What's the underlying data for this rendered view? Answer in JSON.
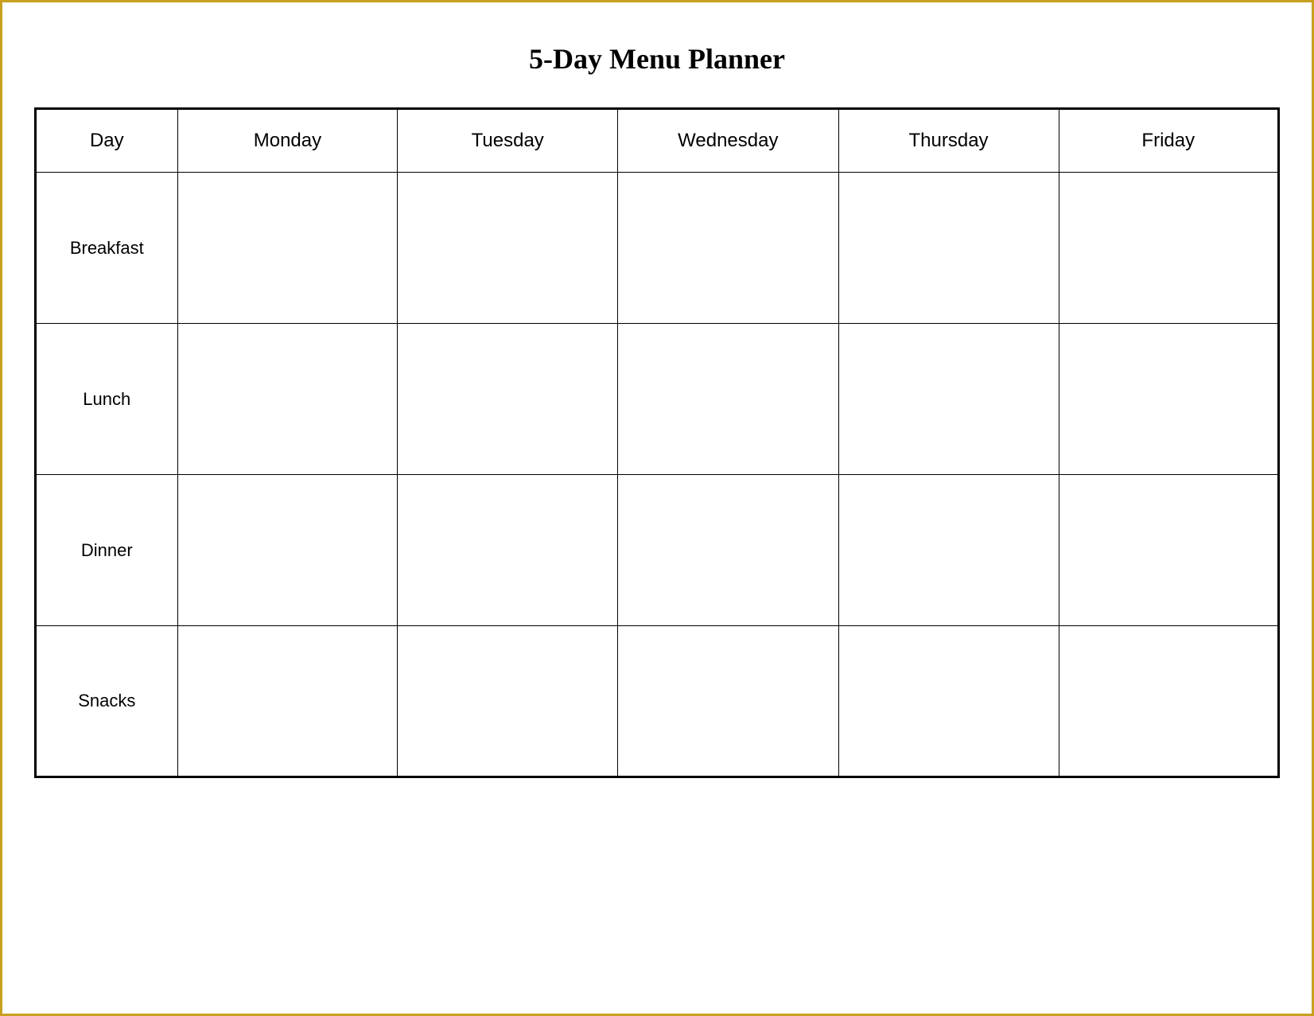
{
  "title": "5-Day Menu Planner",
  "table": {
    "headers": {
      "day": "Day",
      "monday": "Monday",
      "tuesday": "Tuesday",
      "wednesday": "Wednesday",
      "thursday": "Thursday",
      "friday": "Friday"
    },
    "rows": [
      {
        "label": "Breakfast"
      },
      {
        "label": "Lunch"
      },
      {
        "label": "Dinner"
      },
      {
        "label": "Snacks"
      }
    ]
  }
}
